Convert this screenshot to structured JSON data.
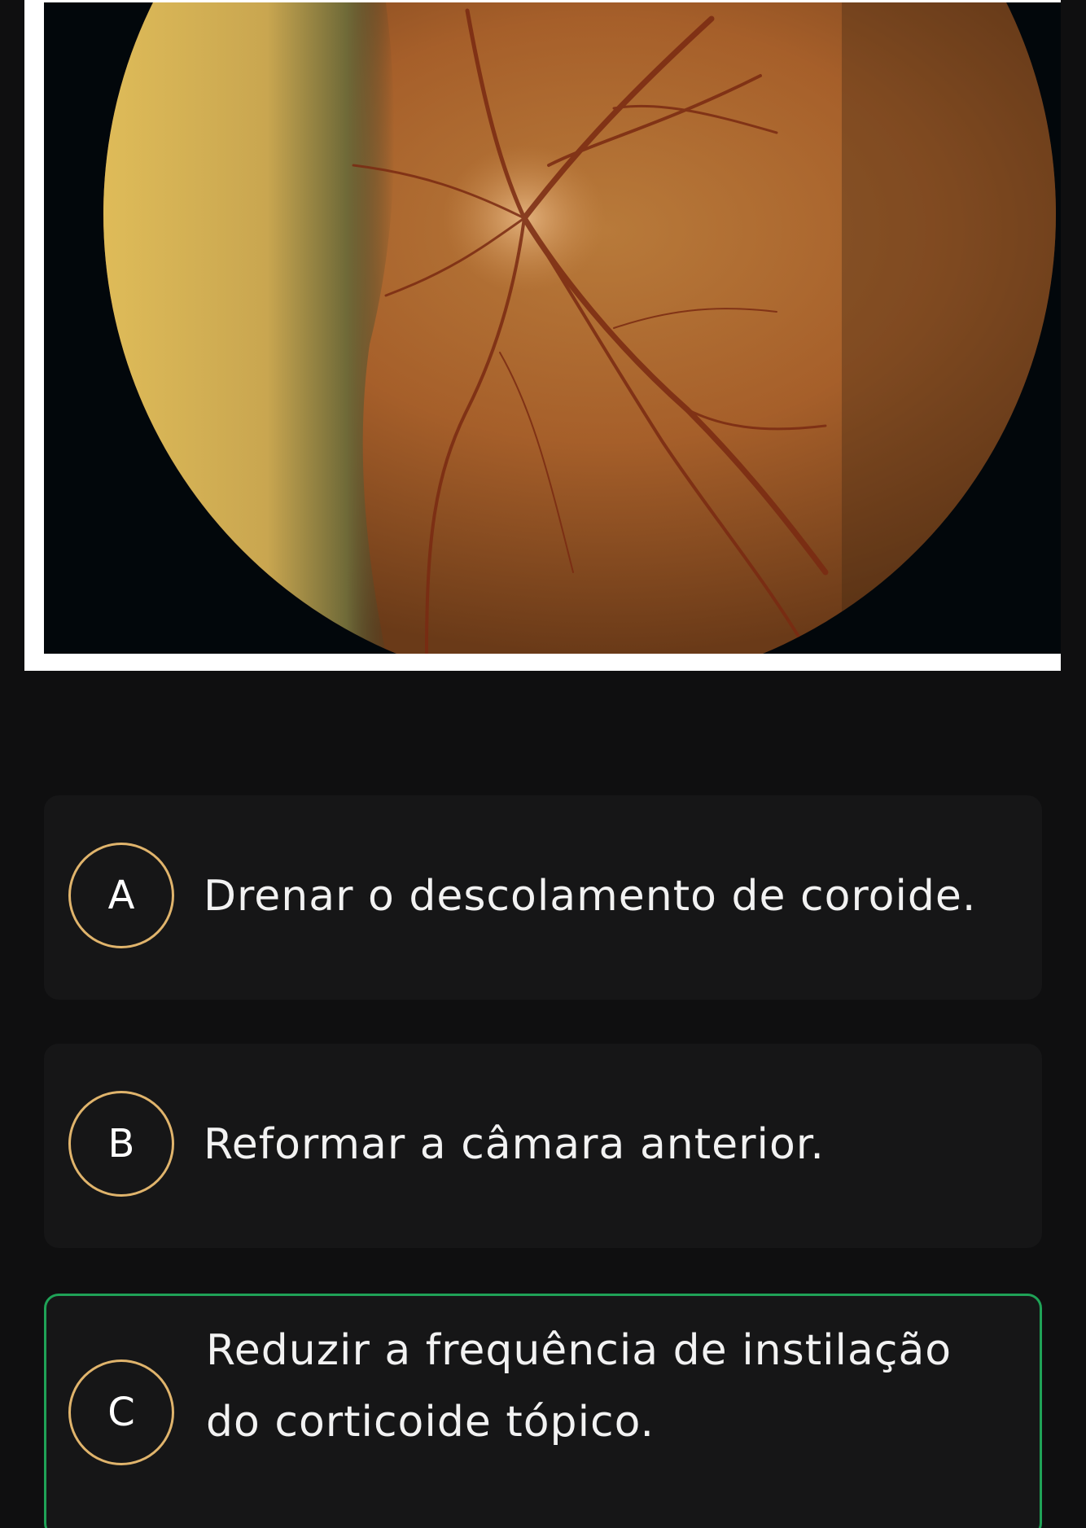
{
  "question": {
    "image": {
      "icon": "fundus-photograph"
    },
    "options": [
      {
        "letter": "A",
        "text": "Drenar o descolamento de coroide.",
        "selected": false
      },
      {
        "letter": "B",
        "text": "Reformar a câmara anterior.",
        "selected": false
      },
      {
        "letter": "C",
        "text": "Reduzir a frequência de instilação do corticoide tópico.",
        "selected": true
      }
    ]
  },
  "colors": {
    "background": "#0f0f10",
    "card": "#161617",
    "letter_ring": "#e0b46c",
    "selected_border": "#1fa257",
    "text": "#f2f2f2"
  }
}
